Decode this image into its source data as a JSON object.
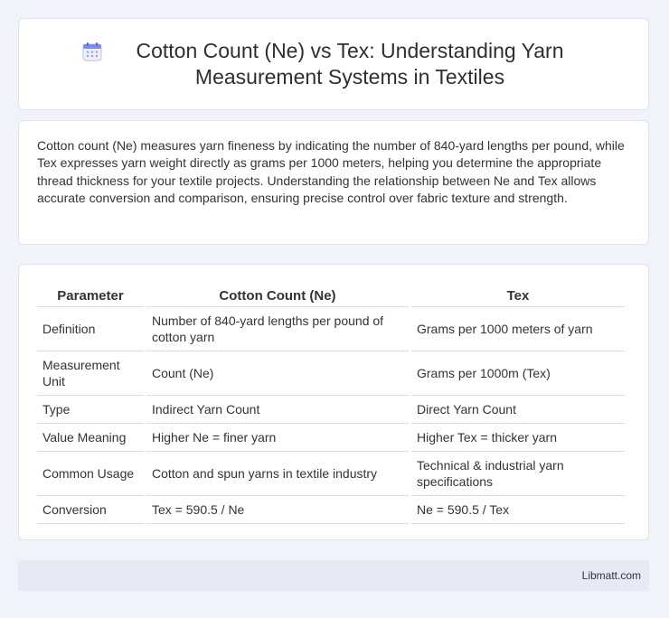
{
  "header": {
    "icon": "calendar-icon",
    "title": "Cotton Count (Ne) vs Tex: Understanding Yarn Measurement Systems in Textiles"
  },
  "intro": {
    "text": "Cotton count (Ne) measures yarn fineness by indicating the number of 840-yard lengths per pound, while Tex expresses yarn weight directly as grams per 1000 meters, helping you determine the appropriate thread thickness for your textile projects. Understanding the relationship between Ne and Tex allows accurate conversion and comparison, ensuring precise control over fabric texture and strength."
  },
  "table": {
    "headers": [
      "Parameter",
      "Cotton Count (Ne)",
      "Tex"
    ],
    "rows": [
      [
        "Definition",
        "Number of 840-yard lengths per pound of cotton yarn",
        "Grams per 1000 meters of yarn"
      ],
      [
        "Measurement Unit",
        "Count (Ne)",
        "Grams per 1000m (Tex)"
      ],
      [
        "Type",
        "Indirect Yarn Count",
        "Direct Yarn Count"
      ],
      [
        "Value Meaning",
        "Higher Ne = finer yarn",
        "Higher Tex = thicker yarn"
      ],
      [
        "Common Usage",
        "Cotton and spun yarns in textile industry",
        "Technical & industrial yarn specifications"
      ],
      [
        "Conversion",
        "Tex = 590.5 / Ne",
        "Ne = 590.5 / Tex"
      ]
    ]
  },
  "footer": {
    "brand": "Libmatt.com"
  }
}
